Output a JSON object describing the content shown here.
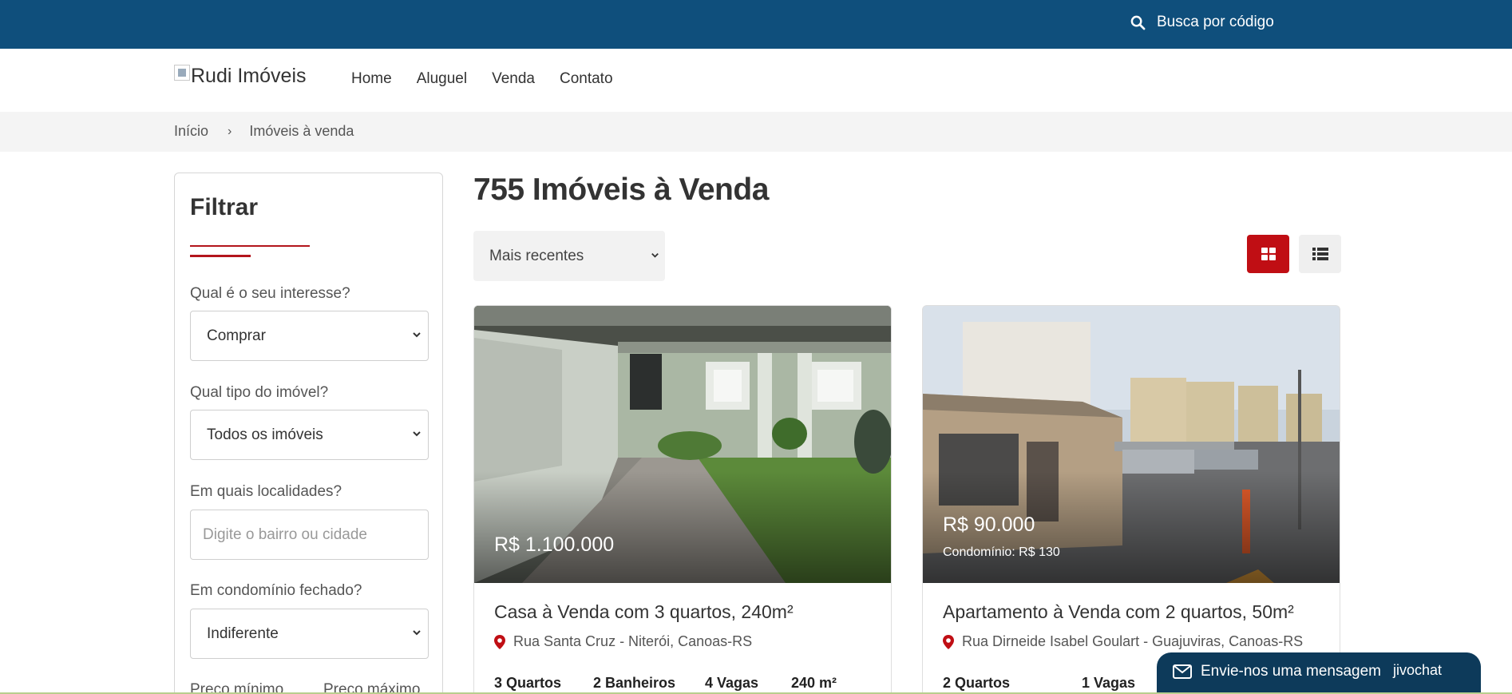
{
  "topbar": {
    "search_label": "Busca por código"
  },
  "header": {
    "logo_alt": "Rudi Imóveis",
    "nav": [
      "Home",
      "Aluguel",
      "Venda",
      "Contato"
    ]
  },
  "breadcrumb": {
    "home": "Início",
    "separator": "›",
    "current": "Imóveis à venda"
  },
  "filter": {
    "title": "Filtrar",
    "interest_label": "Qual é o seu interesse?",
    "interest_value": "Comprar",
    "type_label": "Qual tipo do imóvel?",
    "type_value": "Todos os imóveis",
    "location_label": "Em quais localidades?",
    "location_placeholder": "Digite o bairro ou cidade",
    "condo_label": "Em condomínio fechado?",
    "condo_value": "Indiferente",
    "min_price_label": "Preço mínimo",
    "max_price_label": "Preço máximo"
  },
  "results": {
    "title": "755 Imóveis à Venda",
    "sort_value": "Mais recentes"
  },
  "colors": {
    "topbar": "#0f4f7c",
    "accent": "#c00e14",
    "chat": "#0d3a5a"
  },
  "listings": [
    {
      "price": "R$ 1.100.000",
      "title": "Casa à Venda com 3 quartos, 240m²",
      "address": "Rua Santa Cruz - Niterói, Canoas-RS",
      "features": [
        "3 Quartos",
        "2 Banheiros",
        "4 Vagas",
        "240 m²"
      ]
    },
    {
      "price": "R$ 90.000",
      "condo_fee": "Condomínio: R$ 130",
      "title": "Apartamento à Venda com 2 quartos, 50m²",
      "address": "Rua Dirneide Isabel Goulart - Guajuviras, Canoas-RS",
      "features": [
        "2 Quartos",
        "1 Vagas"
      ]
    }
  ],
  "chat": {
    "label": "Envie-nos uma mensagem",
    "brand": "jivochat"
  }
}
